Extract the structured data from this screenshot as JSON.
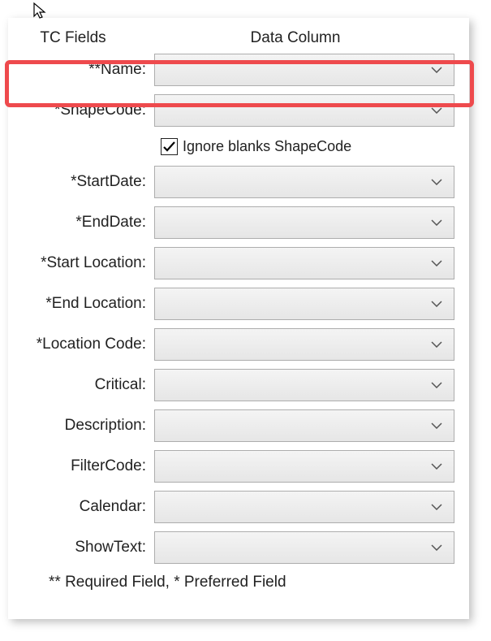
{
  "headers": {
    "tc": "TC Fields",
    "dc": "Data Column"
  },
  "fields": [
    {
      "label": "**Name:"
    },
    {
      "label": "*ShapeCode:"
    },
    {
      "label": "*StartDate:"
    },
    {
      "label": "*EndDate:"
    },
    {
      "label": "*Start Location:"
    },
    {
      "label": "*End Location:"
    },
    {
      "label": "*Location Code:"
    },
    {
      "label": "Critical:"
    },
    {
      "label": "Description:"
    },
    {
      "label": "FilterCode:"
    },
    {
      "label": "Calendar:"
    },
    {
      "label": "ShowText:"
    }
  ],
  "checkbox": {
    "label": "Ignore blanks ShapeCode",
    "checked": true
  },
  "footer": "** Required Field, * Preferred Field"
}
